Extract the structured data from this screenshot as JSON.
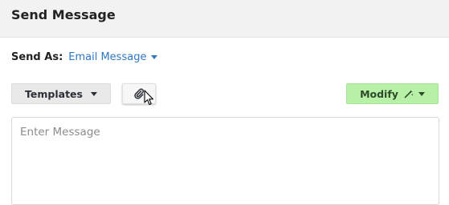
{
  "header": {
    "title": "Send Message"
  },
  "send_as": {
    "label": "Send As:",
    "value": "Email Message"
  },
  "toolbar": {
    "templates_label": "Templates",
    "attach_icon": "paperclip-icon",
    "modify_label": "Modify",
    "modify_icon": "magic-wand-icon"
  },
  "message": {
    "placeholder": "Enter Message"
  },
  "colors": {
    "header_bg": "#f2f2f2",
    "link_blue": "#2e78c2",
    "modify_green": "#b7f0a7"
  }
}
